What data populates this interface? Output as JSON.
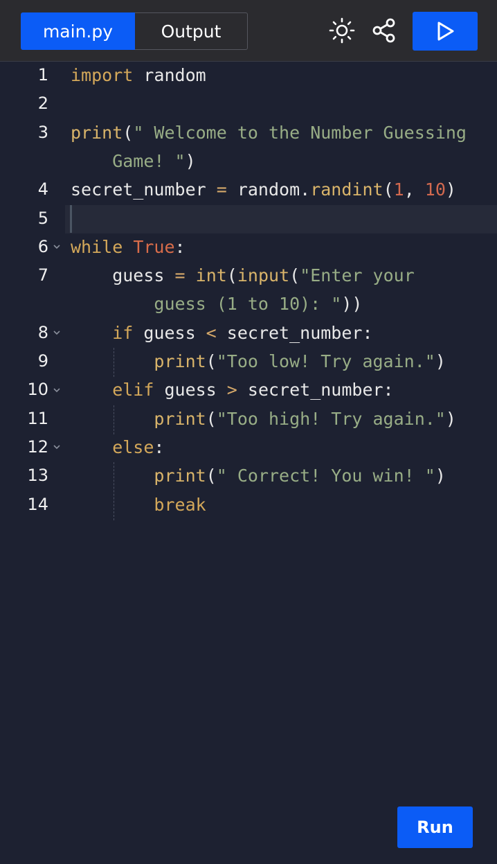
{
  "tabs": {
    "main_label": "main.py",
    "output_label": "Output"
  },
  "toolbar": {
    "theme_icon": "sun-icon",
    "share_icon": "share-icon",
    "run_icon": "play-icon"
  },
  "editor": {
    "line_numbers": [
      "1",
      "2",
      "3",
      "",
      "4",
      "5",
      "6",
      "7",
      "",
      "8",
      "9",
      "10",
      "11",
      "12",
      "13",
      "14"
    ],
    "lines": [
      {
        "parts": [
          [
            "kw",
            "import"
          ],
          [
            "pl",
            " random"
          ]
        ]
      },
      {
        "parts": []
      },
      {
        "parts": [
          [
            "fn",
            "print"
          ],
          [
            "pl",
            "("
          ],
          [
            "str",
            "\" Welcome to the Number Guessing"
          ]
        ]
      },
      {
        "parts": [
          [
            "str",
            "    Game! \""
          ],
          [
            "pl",
            ")"
          ]
        ]
      },
      {
        "parts": [
          [
            "pl",
            "secret_number "
          ],
          [
            "op",
            "="
          ],
          [
            "pl",
            " random."
          ],
          [
            "fn",
            "randint"
          ],
          [
            "pl",
            "("
          ],
          [
            "num",
            "1"
          ],
          [
            "pl",
            ", "
          ],
          [
            "num",
            "10"
          ],
          [
            "pl",
            ")"
          ]
        ]
      },
      {
        "parts": []
      },
      {
        "parts": [
          [
            "kw",
            "while"
          ],
          [
            "pl",
            " "
          ],
          [
            "tru",
            "True"
          ],
          [
            "pl",
            ":"
          ]
        ]
      },
      {
        "parts": [
          [
            "pl",
            "    guess "
          ],
          [
            "op",
            "="
          ],
          [
            "pl",
            " "
          ],
          [
            "fn",
            "int"
          ],
          [
            "pl",
            "("
          ],
          [
            "fn",
            "input"
          ],
          [
            "pl",
            "("
          ],
          [
            "str",
            "\"Enter your"
          ]
        ]
      },
      {
        "parts": [
          [
            "str",
            "        guess (1 to 10): \""
          ],
          [
            "pl",
            "))"
          ]
        ]
      },
      {
        "parts": [
          [
            "kw",
            "    if"
          ],
          [
            "pl",
            " guess "
          ],
          [
            "op",
            "<"
          ],
          [
            "pl",
            " secret_number:"
          ]
        ]
      },
      {
        "parts": [
          [
            "fn",
            "        print"
          ],
          [
            "pl",
            "("
          ],
          [
            "str",
            "\"Too low! Try again.\""
          ],
          [
            "pl",
            ")"
          ]
        ]
      },
      {
        "parts": [
          [
            "kw",
            "    elif"
          ],
          [
            "pl",
            " guess "
          ],
          [
            "op",
            ">"
          ],
          [
            "pl",
            " secret_number:"
          ]
        ]
      },
      {
        "parts": [
          [
            "fn",
            "        print"
          ],
          [
            "pl",
            "("
          ],
          [
            "str",
            "\"Too high! Try again.\""
          ],
          [
            "pl",
            ")"
          ]
        ]
      },
      {
        "parts": [
          [
            "kw",
            "    else"
          ],
          [
            "pl",
            ":"
          ]
        ]
      },
      {
        "parts": [
          [
            "fn",
            "        print"
          ],
          [
            "pl",
            "("
          ],
          [
            "str",
            "\" Correct! You win! \""
          ],
          [
            "pl",
            ")"
          ]
        ]
      },
      {
        "parts": [
          [
            "kw",
            "        break"
          ]
        ]
      }
    ]
  },
  "run_button": {
    "label": "Run"
  },
  "colors": {
    "accent": "#0b5cf6",
    "background": "#1d2131",
    "topbar": "#2b2b2f"
  }
}
